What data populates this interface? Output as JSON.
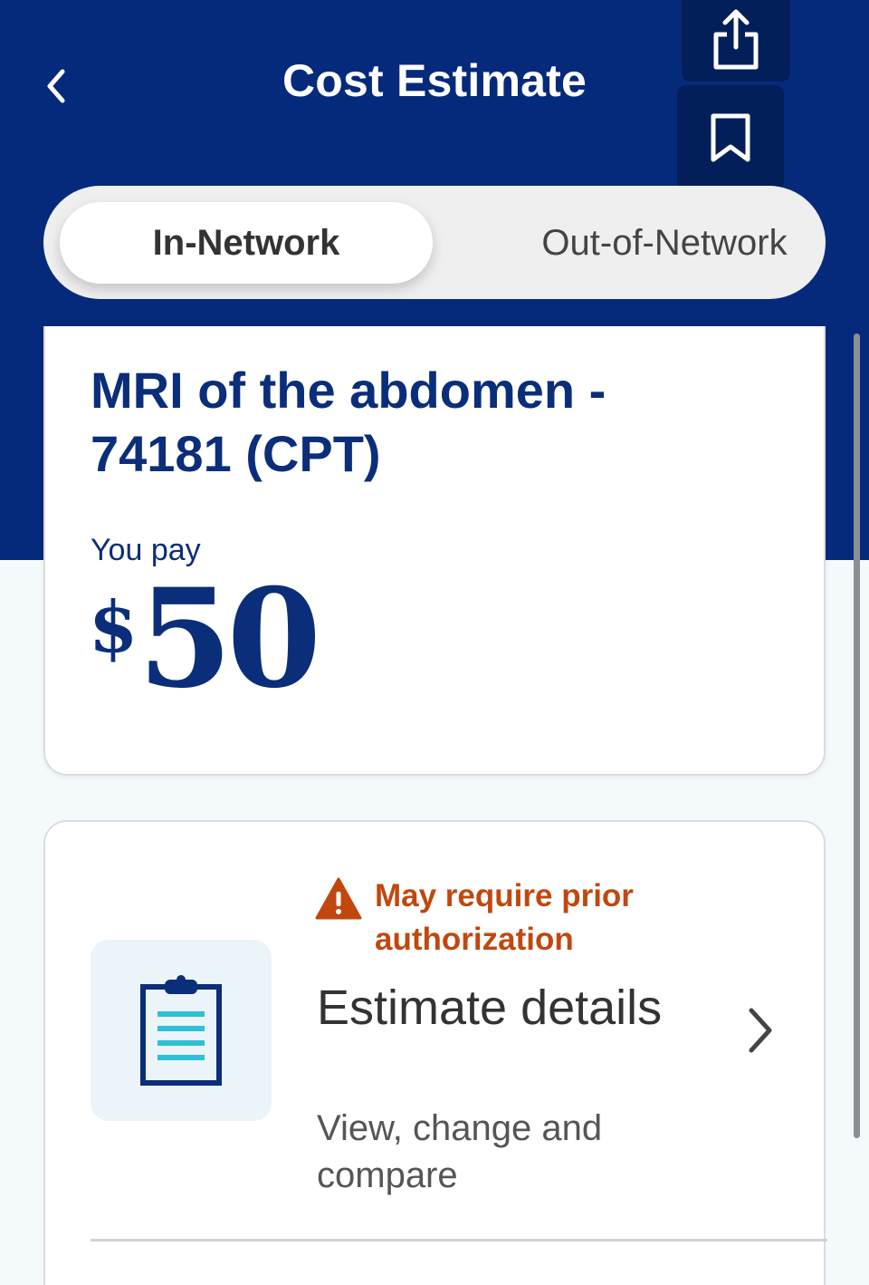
{
  "header": {
    "title": "Cost Estimate",
    "back_icon": "chevron-left-icon",
    "share_icon": "share-icon",
    "bookmark_icon": "bookmark-icon",
    "background_color": "#062a7b"
  },
  "network_toggle": {
    "options": [
      {
        "label": "In-Network",
        "selected": true
      },
      {
        "label": "Out-of-Network",
        "selected": false
      }
    ]
  },
  "cost_card": {
    "procedure": "MRI of the abdomen - 74181 (CPT)",
    "you_pay_label": "You pay",
    "currency": "$",
    "amount": "50"
  },
  "estimate_card": {
    "warning": "May require prior authorization",
    "warning_color": "#c0480f",
    "title": "Estimate details",
    "subtitle": "View, change and compare",
    "icon": "clipboard-icon"
  }
}
